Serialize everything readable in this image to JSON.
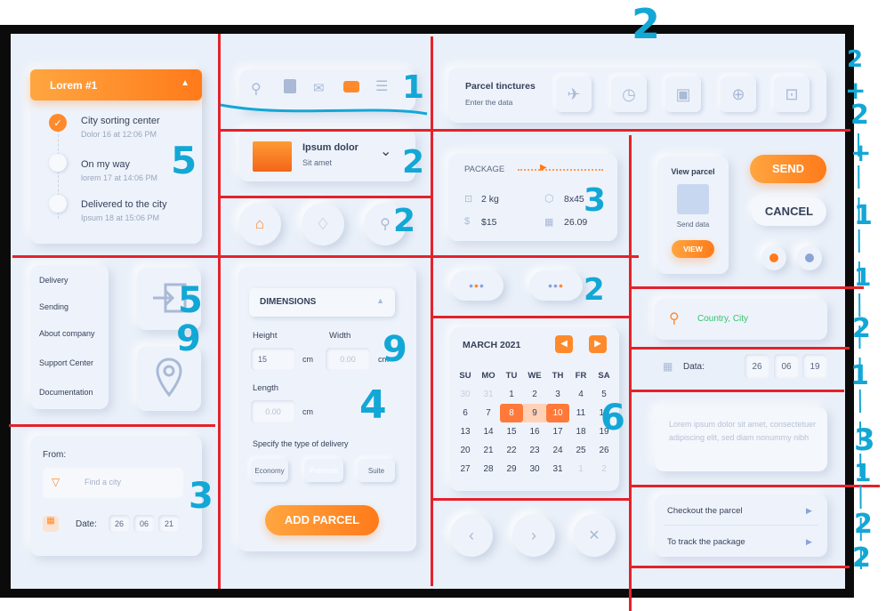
{
  "tracking": {
    "header": "Lorem #1",
    "steps": [
      {
        "title": "City sorting center",
        "sub": "Dolor 16 at 12:06 PM"
      },
      {
        "title": "On my way",
        "sub": "lorem 17 at 14:06 PM"
      },
      {
        "title": "Delivered to the city",
        "sub": "Ipsum 18 at 15:06 PM"
      }
    ]
  },
  "menu": {
    "items": [
      "Delivery",
      "Sending",
      "About company",
      "Support Center",
      "Documentation"
    ]
  },
  "from_form": {
    "label": "From:",
    "city_placeholder": "Find a city",
    "date_label": "Date:",
    "day": "26",
    "month": "06",
    "year": "21"
  },
  "parcel_item": {
    "title": "Ipsum dolor",
    "sub": "Sit amet"
  },
  "dimensions": {
    "header": "DIMENSIONS",
    "height_label": "Height",
    "width_label": "Width",
    "height_value": "15",
    "width_placeholder": "0.00",
    "length_label": "Length",
    "length_placeholder": "0.00",
    "unit": "cm",
    "delivery_label": "Specify the type of delivery",
    "types": [
      "Economy",
      "Premium",
      "Suite"
    ],
    "add_button": "ADD PARCEL"
  },
  "tinctures": {
    "title": "Parcel tinctures",
    "sub": "Enter the data"
  },
  "package": {
    "label": "PACKAGE",
    "weight": "2 kg",
    "size": "8x45",
    "price": "$15",
    "date": "26.09"
  },
  "calendar": {
    "month": "MARCH 2021",
    "weekdays": [
      "SU",
      "MO",
      "TU",
      "WE",
      "TH",
      "FR",
      "SA"
    ],
    "rows": [
      [
        "30",
        "31",
        "1",
        "2",
        "3",
        "4",
        "5"
      ],
      [
        "6",
        "7",
        "8",
        "9",
        "10",
        "11",
        "12"
      ],
      [
        "13",
        "14",
        "15",
        "16",
        "17",
        "18",
        "19"
      ],
      [
        "20",
        "21",
        "22",
        "23",
        "24",
        "25",
        "26"
      ],
      [
        "27",
        "28",
        "29",
        "30",
        "31",
        "1",
        "2"
      ]
    ]
  },
  "view_parcel": {
    "title": "View parcel",
    "sub": "Send data",
    "button": "VIEW"
  },
  "actions": {
    "send": "SEND",
    "cancel": "CANCEL"
  },
  "location": {
    "placeholder": "Country, City",
    "accent": "#33c26b"
  },
  "date_row": {
    "label": "Data:",
    "day": "26",
    "month": "06",
    "year": "19"
  },
  "note": {
    "text": "Lorem ipsum dolor sit amet, consectetuer adipiscing elit, sed diam nonummy nibh"
  },
  "links": [
    "Checkout the parcel",
    "To track the package"
  ],
  "annotations": [
    "2",
    "1",
    "2",
    "2",
    "3",
    "2",
    "5",
    "5",
    "9",
    "3",
    "4",
    "9",
    "6",
    "2",
    "+",
    "2",
    "+",
    "1",
    "1",
    "2",
    "1",
    "3",
    "1",
    "2",
    "2"
  ],
  "colors": {
    "accent": "#ff8a2b",
    "grid_line": "#e3222b",
    "note_ink": "#13a7d6"
  }
}
